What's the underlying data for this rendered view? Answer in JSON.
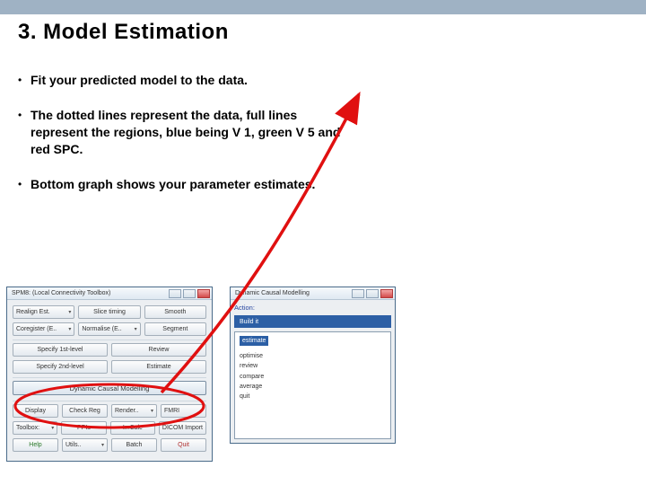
{
  "title": "3. Model Estimation",
  "bullets": [
    "Fit your predicted model to the data.",
    "The dotted lines represent the data, full lines represent the regions, blue being V 1, green V 5 and red SPC.",
    "Bottom graph shows your parameter estimates."
  ],
  "spm": {
    "window_title": "SPM8: (Local Connectivity Toolbox)",
    "rows": [
      [
        "Realign Est.",
        "Slice timing",
        "Smooth"
      ],
      [
        "Coregister (E..",
        "Normalise (E..",
        "Segment"
      ]
    ],
    "mid": [
      [
        "Specify 1st-level",
        "Review"
      ],
      [
        "Specify 2nd-level",
        "Estimate"
      ]
    ],
    "dcm_button": "Dynamic Causal Modelling",
    "bottom": [
      [
        "Display",
        "Check Reg",
        "Render..",
        "FMRI"
      ],
      [
        "Toolbox:",
        "PPIs",
        "ImCalc",
        "DICOM Import"
      ],
      [
        "Help",
        "Utils..",
        "Batch",
        "Quit"
      ]
    ]
  },
  "dcm": {
    "window_title": "Dynamic Causal Modelling",
    "action_label": "Action:",
    "action_sel": "Build it",
    "list_sel": "estimate",
    "list_items": [
      "optimise",
      "review",
      "compare",
      "average",
      "quit"
    ]
  },
  "annotation_color": "#e01010"
}
